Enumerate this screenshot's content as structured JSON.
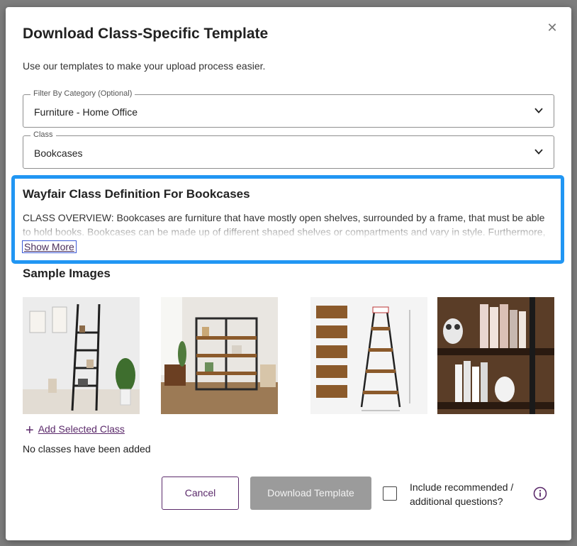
{
  "modal": {
    "title": "Download Class-Specific Template",
    "subtitle": "Use our templates to make your upload process easier.",
    "close_symbol": "✕"
  },
  "filter_category": {
    "legend": "Filter By Category (Optional)",
    "value": "Furniture - Home Office"
  },
  "class_select": {
    "legend": "Class",
    "value": "Bookcases"
  },
  "definition": {
    "title": "Wayfair Class Definition For Bookcases",
    "text": "CLASS OVERVIEW: Bookcases are furniture that have mostly open shelves, surrounded by a frame, that must be able to hold books. Bookcases can be made up of different shaped shelves or compartments and vary in style. Furthermore, they",
    "show_more": "Show More"
  },
  "samples": {
    "heading": "Sample Images",
    "images": [
      "ladder-bookcase-photo",
      "etagere-bookcase-photo",
      "dimension-diagram-photo",
      "bookcase-closeup-photo"
    ]
  },
  "add_class": {
    "plus": "+",
    "label": "Add Selected Class"
  },
  "no_classes_text": "No classes have been added",
  "footer": {
    "cancel": "Cancel",
    "download": "Download Template",
    "include_label": "Include recommended / additional questions?"
  },
  "colors": {
    "accent": "#5b2a6b",
    "highlight": "#2196f3",
    "disabled": "#9b9b9b"
  }
}
